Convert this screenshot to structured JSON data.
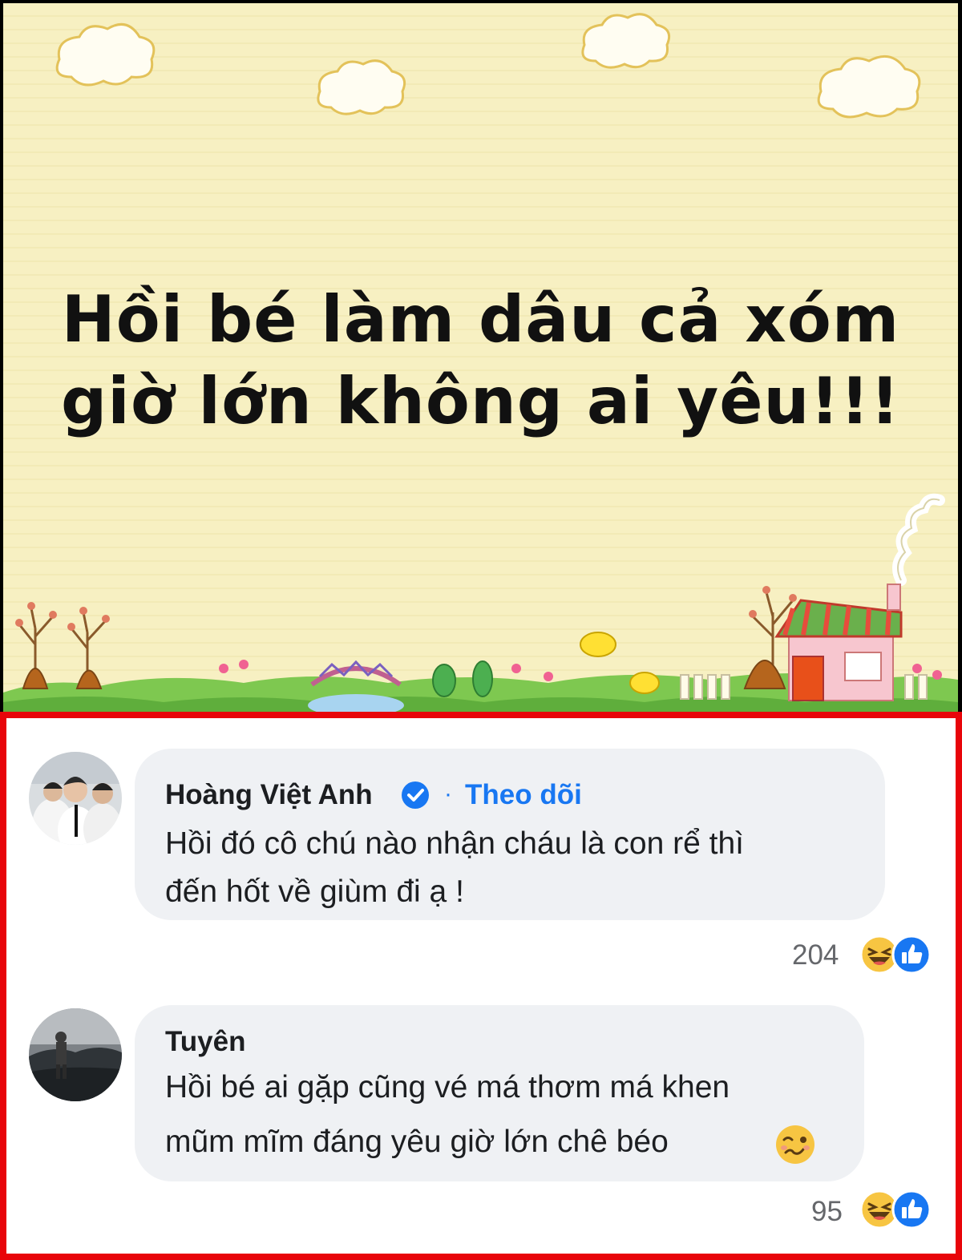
{
  "banner": {
    "headline_line1": "Hồi bé làm dâu cả xóm",
    "headline_line2": "giờ lớn không ai yêu!!!",
    "background_color": "#f7f0c2"
  },
  "comments": [
    {
      "author": "Hoàng Việt Anh",
      "verified": true,
      "follow_separator": "·",
      "follow_label": "Theo dõi",
      "text_line1": "Hồi đó cô chú nào nhận cháu là con rể thì",
      "text_line2": "đến hốt về giùm đi ạ !",
      "reaction_count": "204",
      "reactions": [
        "haha-icon",
        "like-icon"
      ]
    },
    {
      "author": "Tuyên",
      "verified": false,
      "text_line1": "Hồi bé ai gặp cũng vé má thơm má khen",
      "text_line2": "mũm mĩm đáng yêu giờ lớn chê béo",
      "text_emoji": "woozy-face-icon",
      "reaction_count": "95",
      "reactions": [
        "haha-icon",
        "like-icon"
      ]
    }
  ],
  "colors": {
    "panel_border": "#e8050a",
    "bubble": "#eff1f4",
    "link_blue": "#1877f2"
  }
}
